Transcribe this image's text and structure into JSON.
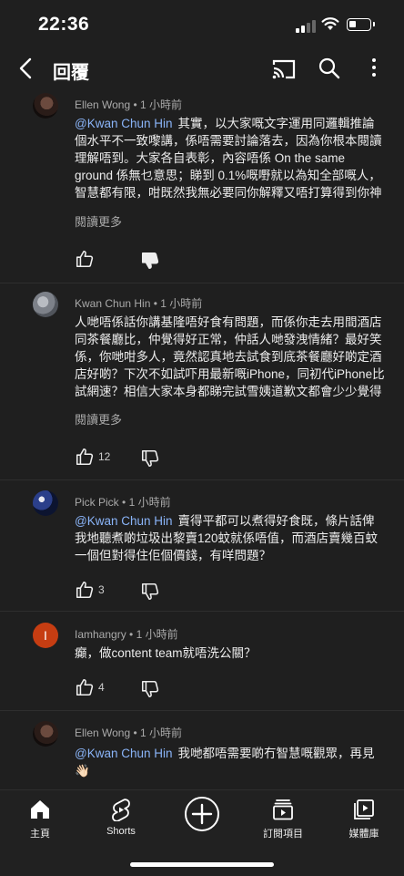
{
  "status_bar": {
    "time": "22:36"
  },
  "header": {
    "title": "回覆"
  },
  "comments": [
    {
      "author": "Ellen Wong",
      "time": "1 小時前",
      "mention": "@Kwan Chun Hin",
      "text": "其實，以大家嘅文字運用同邏輯推論個水平不一致嚟講，係唔需要討論落去，因為你根本閱讀理解唔到。大家各自表彰，內容唔係 On the same ground 係無乜意思；睇到 0.1%嘅嘢就以為知全部嘅人，智慧都有限，咁既然我無必要同你解釋又唔打算得到你神",
      "read_more": "閱讀更多",
      "likes": ""
    },
    {
      "author": "Kwan Chun Hin",
      "time": "1 小時前",
      "mention": "",
      "text": "人哋唔係話你講基隆唔好食有問題，而係你走去用間酒店同茶餐廳比，仲覺得好正常，仲話人哋發洩情緒？最好笑係，你哋咁多人，竟然認真地去試食到底茶餐廳好啲定酒店好啲？下次不如試吓用最新嘅iPhone，同初代iPhone比試網速？相信大家本身都睇完試雪姨道歉文都會少少覺得",
      "read_more": "閱讀更多",
      "likes": "12"
    },
    {
      "author": "Pick Pick",
      "time": "1 小時前",
      "mention": "@Kwan Chun Hin",
      "text": "賣得平都可以煮得好食既，條片話俾我地聽煮啲垃圾出黎賣120蚊就係唔值，而酒店賣幾百蚊一個但對得住佢個價錢，有咩問題？",
      "read_more": "",
      "likes": "3"
    },
    {
      "author": "Iamhangry",
      "time": "1 小時前",
      "avatar_letter": "I",
      "mention": "",
      "text": "癲，做content team就唔洗公關？",
      "read_more": "",
      "likes": "4"
    },
    {
      "author": "Ellen Wong",
      "time": "1 小時前",
      "mention": "@Kwan Chun Hin",
      "text": "我哋都唔需要啲冇智慧嘅觀眾，再見👋🏻",
      "read_more": "",
      "likes": ""
    }
  ],
  "meta_separator": "•",
  "bottom_nav": {
    "home": "主頁",
    "shorts": "Shorts",
    "subscriptions": "訂閱項目",
    "library": "媒體庫"
  },
  "colors": {
    "background": "#1f1f1f",
    "mention": "#8ab4f8",
    "avatar_letter_bg": "#c63d12"
  },
  "icons": [
    "back-arrow-icon",
    "cast-icon",
    "search-icon",
    "more-vert-icon",
    "thumb-up-icon",
    "thumb-down-icon",
    "home-icon",
    "shorts-icon",
    "create-icon",
    "subscriptions-icon",
    "library-icon"
  ]
}
